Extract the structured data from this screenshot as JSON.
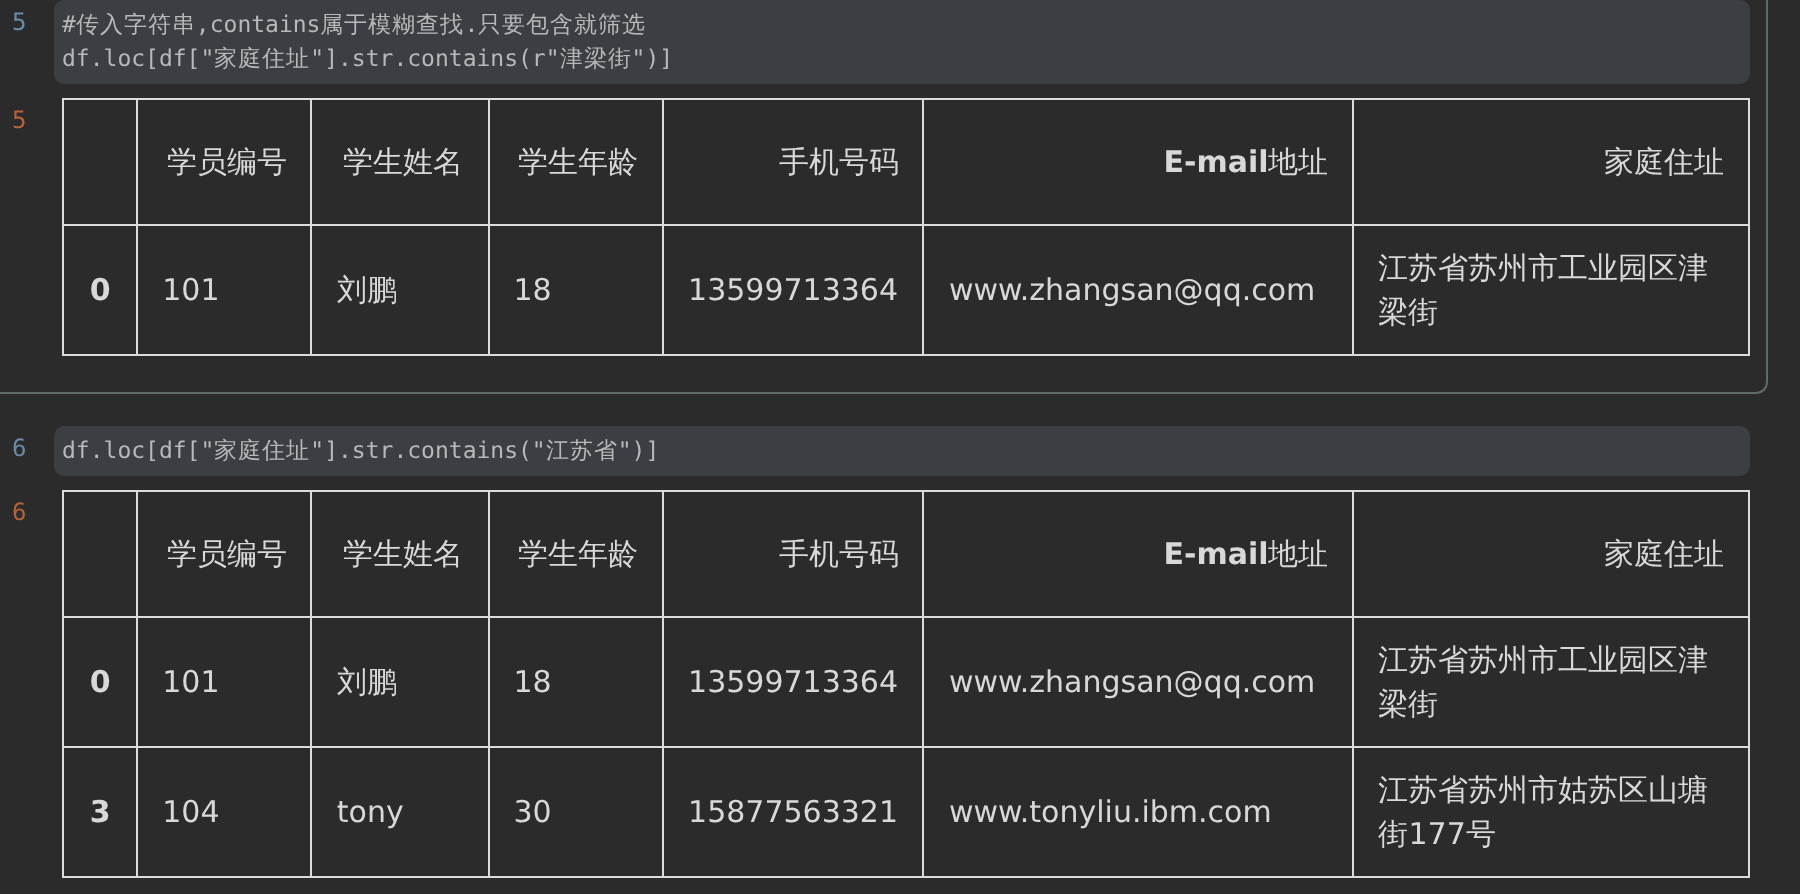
{
  "cells": [
    {
      "prompt": "5",
      "selected": true,
      "code": [
        "#传入字符串,contains属于模糊查找.只要包含就筛选",
        "df.loc[df[\"家庭住址\"].str.contains(r\"津梁街\")]"
      ],
      "out_prompt": "5",
      "table": {
        "columns": [
          "学员编号",
          "学生姓名",
          "学生年龄",
          "手机号码",
          "**E-mail**地址",
          "家庭住址"
        ],
        "rows": [
          {
            "index": "0",
            "cells": [
              "101",
              "刘鹏",
              "18",
              "13599713364",
              "www.zhangsan@qq.com",
              "江苏省苏州市工业园区津梁街"
            ]
          }
        ]
      }
    },
    {
      "prompt": "6",
      "selected": false,
      "code": [
        "df.loc[df[\"家庭住址\"].str.contains(\"江苏省\")]"
      ],
      "out_prompt": "6",
      "table": {
        "columns": [
          "学员编号",
          "学生姓名",
          "学生年龄",
          "手机号码",
          "**E-mail**地址",
          "家庭住址"
        ],
        "rows": [
          {
            "index": "0",
            "cells": [
              "101",
              "刘鹏",
              "18",
              "13599713364",
              "www.zhangsan@qq.com",
              "江苏省苏州市工业园区津梁街"
            ]
          },
          {
            "index": "3",
            "cells": [
              "104",
              "tony",
              "30",
              "15877563321",
              "www.tonyliu.ibm.com",
              "江苏省苏州市姑苏区山塘街177号"
            ]
          }
        ]
      }
    }
  ]
}
